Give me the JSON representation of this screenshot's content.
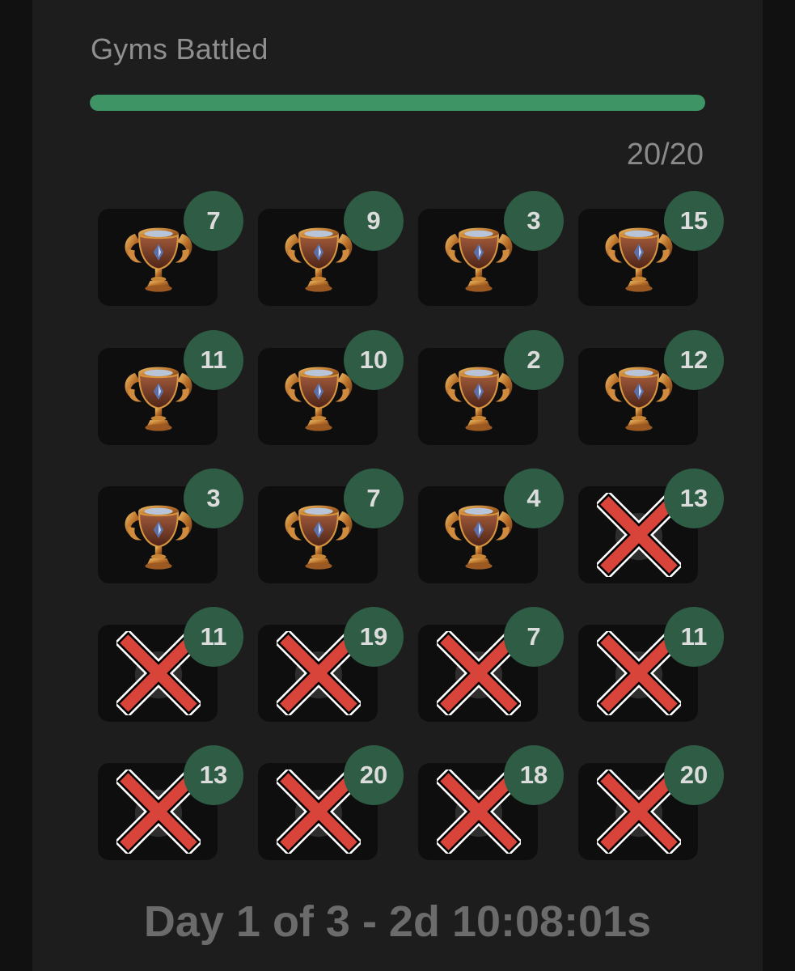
{
  "header": {
    "title": "Gyms Battled",
    "progress_fraction": 1.0,
    "progress_count": "20/20"
  },
  "colors": {
    "progress": "#3f9466",
    "badge": "#2e5c44",
    "cross": "#d9443a"
  },
  "gyms": [
    {
      "count": "7",
      "status": "won",
      "icon": "trophy-icon"
    },
    {
      "count": "9",
      "status": "won",
      "icon": "trophy-icon"
    },
    {
      "count": "3",
      "status": "won",
      "icon": "trophy-icon"
    },
    {
      "count": "15",
      "status": "won",
      "icon": "trophy-icon"
    },
    {
      "count": "11",
      "status": "won",
      "icon": "trophy-icon"
    },
    {
      "count": "10",
      "status": "won",
      "icon": "trophy-icon"
    },
    {
      "count": "2",
      "status": "won",
      "icon": "trophy-icon"
    },
    {
      "count": "12",
      "status": "won",
      "icon": "trophy-icon"
    },
    {
      "count": "3",
      "status": "won",
      "icon": "trophy-icon"
    },
    {
      "count": "7",
      "status": "won",
      "icon": "trophy-icon"
    },
    {
      "count": "4",
      "status": "won",
      "icon": "trophy-icon"
    },
    {
      "count": "13",
      "status": "lost",
      "icon": "red-x-icon"
    },
    {
      "count": "11",
      "status": "lost",
      "icon": "red-x-icon"
    },
    {
      "count": "19",
      "status": "lost",
      "icon": "red-x-icon"
    },
    {
      "count": "7",
      "status": "lost",
      "icon": "red-x-icon"
    },
    {
      "count": "11",
      "status": "lost",
      "icon": "red-x-icon"
    },
    {
      "count": "13",
      "status": "lost",
      "icon": "red-x-icon"
    },
    {
      "count": "20",
      "status": "lost",
      "icon": "red-x-icon"
    },
    {
      "count": "18",
      "status": "lost",
      "icon": "red-x-icon"
    },
    {
      "count": "20",
      "status": "lost",
      "icon": "red-x-icon"
    }
  ],
  "footer": {
    "timer_text": "Day 1 of 3 - 2d 10:08:01s"
  }
}
